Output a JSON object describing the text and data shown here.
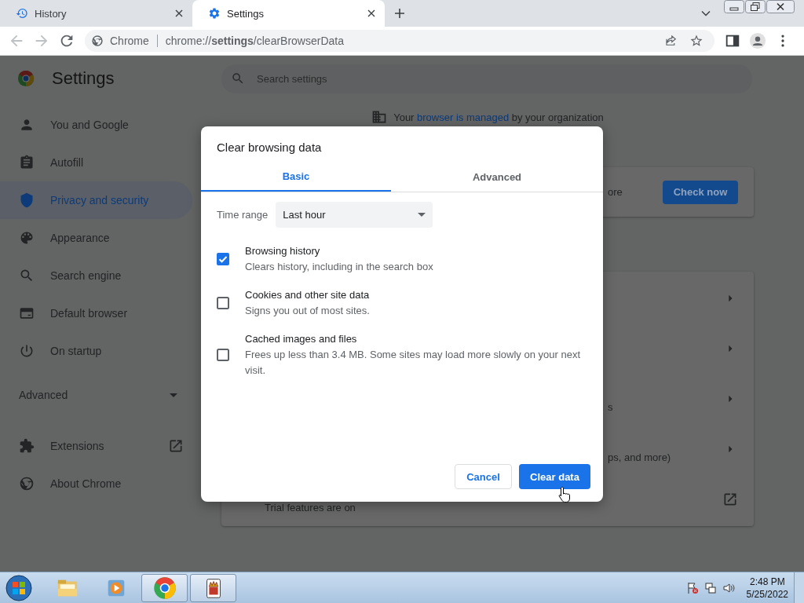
{
  "browser_tabs": [
    {
      "kind": "history",
      "title": "History",
      "selected": false
    },
    {
      "kind": "settings",
      "title": "Settings",
      "selected": true
    }
  ],
  "toolbar": {
    "site_label": "Chrome",
    "url": "chrome://**settings**/clearBrowserData"
  },
  "settings": {
    "title": "Settings",
    "search": {
      "placeholder": "Search settings"
    },
    "nav": [
      {
        "kind": "person",
        "label": "You and Google",
        "selected": false
      },
      {
        "kind": "autofill",
        "label": "Autofill",
        "selected": false
      },
      {
        "kind": "shield",
        "label": "Privacy and security",
        "selected": true
      },
      {
        "kind": "palette",
        "label": "Appearance",
        "selected": false
      },
      {
        "kind": "search",
        "label": "Search engine",
        "selected": false
      },
      {
        "kind": "browser",
        "label": "Default browser",
        "selected": false
      },
      {
        "kind": "power",
        "label": "On startup",
        "selected": false
      }
    ],
    "advanced": {
      "label": "Advanced",
      "expanded": false
    },
    "nav_links": [
      {
        "kind": "extensions",
        "label": "Extensions"
      },
      {
        "kind": "about",
        "label": "About Chrome"
      }
    ],
    "managed_notice": {
      "before": "Your",
      "link": "browser is managed",
      "after": "by your organization"
    },
    "safety_card": {
      "text": "ore",
      "button": "Check now"
    },
    "privacy_rows": [
      {
        "kind": "arrow"
      },
      {
        "kind": "arrow"
      },
      {
        "kind": "arrow",
        "text": "s"
      },
      {
        "kind": "arrow",
        "text": "ps, and more)"
      },
      {
        "kind": "external",
        "text": "Trial features are on"
      }
    ]
  },
  "dialog": {
    "title": "Clear browsing data",
    "tabs": [
      {
        "label": "Basic",
        "selected": true
      },
      {
        "label": "Advanced",
        "selected": false
      }
    ],
    "time_range": {
      "label": "Time range",
      "value": "Last hour"
    },
    "options": [
      {
        "title": "Browsing history",
        "description": "Clears history, including in the search box",
        "checked": true
      },
      {
        "title": "Cookies and other site data",
        "description": "Signs you out of most sites.",
        "checked": false
      },
      {
        "title": "Cached images and files",
        "description": "Frees up less than 3.4 MB. Some sites may load more slowly on your next visit.",
        "checked": false
      }
    ],
    "cancel": "Cancel",
    "confirm": "Clear data"
  },
  "taskbar": {
    "apps": [
      {
        "kind": "explorer",
        "running": false
      },
      {
        "kind": "media",
        "running": false
      },
      {
        "kind": "chrome",
        "running": true
      },
      {
        "kind": "solitaire",
        "running": true
      }
    ],
    "clock": {
      "time": "2:48 PM",
      "date": "5/25/2022"
    }
  }
}
